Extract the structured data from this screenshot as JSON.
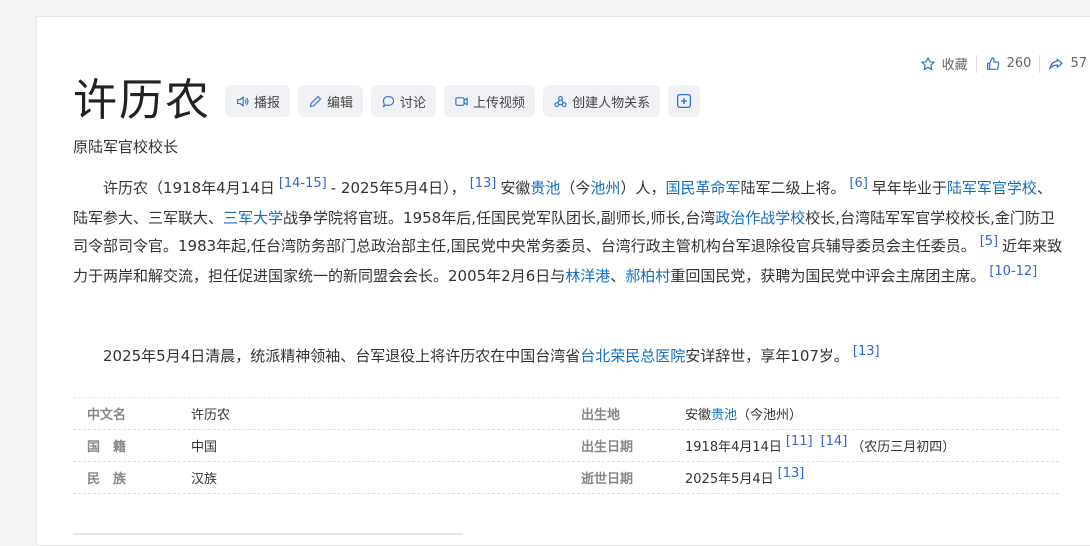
{
  "actions": {
    "favorite": "收藏",
    "likes": "260",
    "shares": "57"
  },
  "title": "许历农",
  "toolbar": {
    "broadcast": "播报",
    "edit": "编辑",
    "discuss": "讨论",
    "upload_video": "上传视频",
    "relations": "创建人物关系"
  },
  "subtitle": "原陆军官校校长",
  "para1": {
    "t1": "许历农（1918年4月14日",
    "r1": "[14-15]",
    "t2": "- 2025年5月4日），",
    "r2": "[13]",
    "t3": "安徽",
    "l1": "贵池",
    "t4": "（今",
    "l2": "池州",
    "t5": "）人，",
    "l3": "国民革命军",
    "t6": "陆军二级上将。",
    "r3": "[6]",
    "t7": "早年毕业于",
    "l4": "陆军军官学校",
    "t8": "、陆军参大、三军联大、",
    "l5": "三军大学",
    "t9": "战争学院将官班。1958年后,任国民党军队团长,副师长,师长,台湾",
    "l6": "政治作战学校",
    "t10": "校长,台湾陆军军官学校校长,金门防卫司令部司令官。1983年起,任台湾防务部门总政治部主任,国民党中央常务委员、台湾行政主管机构台军退除役官兵辅导委员会主任委员。",
    "r4": "[5]",
    "t11": "近年来致力于两岸和解交流，担任促进国家统一的新同盟会会长。2005年2月6日与",
    "l7": "林洋港",
    "t12": "、",
    "l8": "郝柏村",
    "t13": "重回国民党，获聘为国民党中评会主席团主席。",
    "r5": "[10-12]"
  },
  "para2": {
    "t1": "2025年5月4日清晨，统派精神领袖、台军退役上将许历农在中国台湾省",
    "l1": "台北荣民总医院",
    "t2": "安详辞世，享年107岁。",
    "r1": "[13]"
  },
  "infobox": {
    "row1": {
      "l": "中文名",
      "v": "许历农",
      "l2": "出生地",
      "v2a": "安徽",
      "v2b": "贵池",
      "v2c": "（今池州）"
    },
    "row2": {
      "l": "国　籍",
      "v": "中国",
      "l2": "出生日期",
      "v2a": "1918年4月14日",
      "r1": "[11]",
      "r2": "[14]",
      "v2c": "（农历三月初四）"
    },
    "row3": {
      "l": "民　族",
      "v": "汉族",
      "l2": "逝世日期",
      "v2a": "2025年5月4日",
      "r1": "[13]"
    }
  }
}
